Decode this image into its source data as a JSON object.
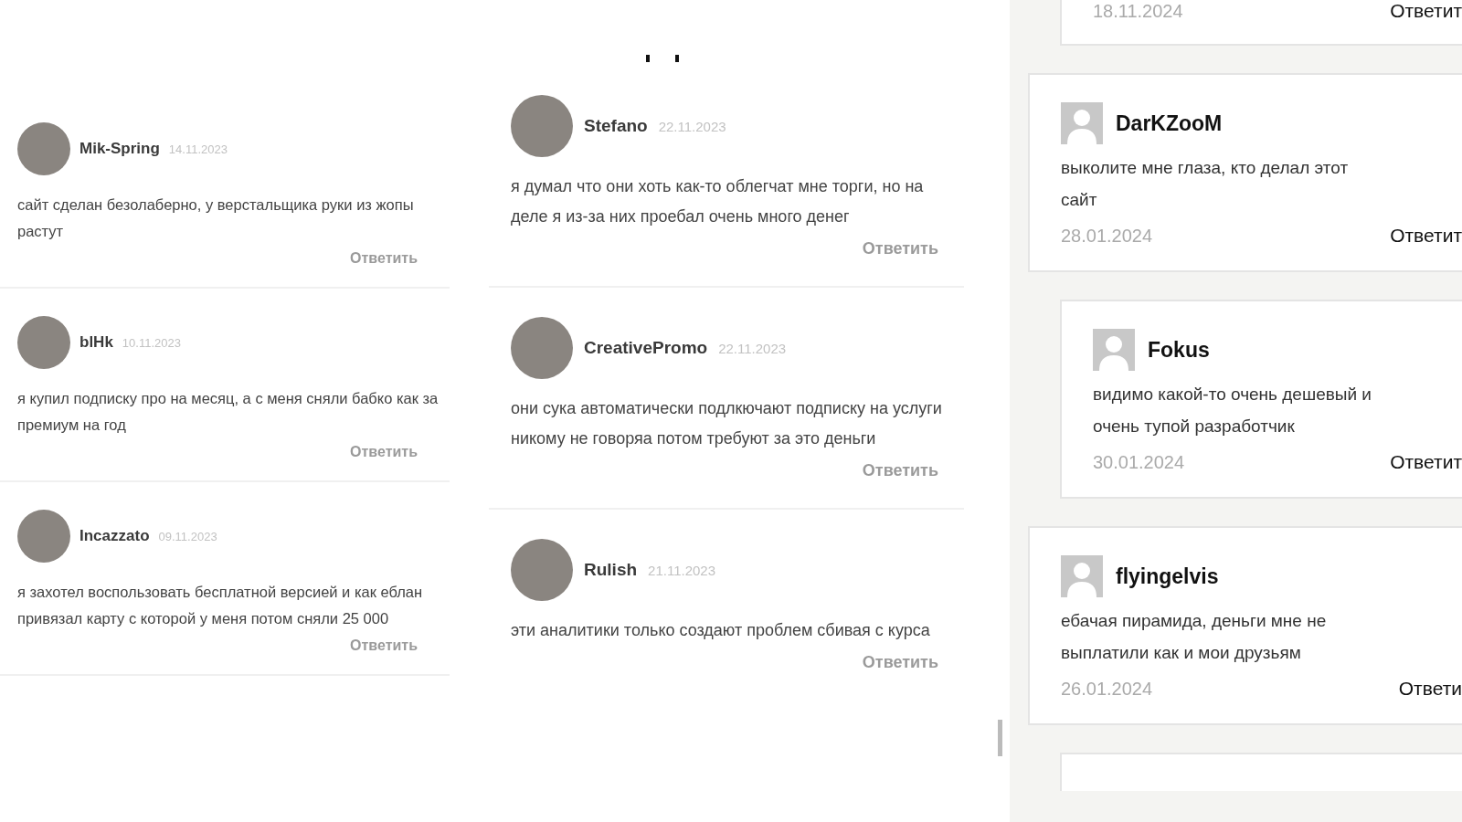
{
  "left_column": {
    "comments": [
      {
        "author": "Mik-Spring",
        "date": "14.11.2023",
        "text": "сайт сделан безолаберно, у верстальщика руки из жопы растут",
        "reply": "Ответить"
      },
      {
        "author": "blHk",
        "date": "10.11.2023",
        "text": "я купил подписку про на месяц, а с меня сняли бабко как за премиум на год",
        "reply": "Ответить"
      },
      {
        "author": "Incazzato",
        "date": "09.11.2023",
        "text": "я захотел воспользовать бесплатной версией и как еблан привязал карту с которой у меня потом сняли 25 000",
        "reply": "Ответить"
      }
    ]
  },
  "middle_column": {
    "comments": [
      {
        "author": "Stefano",
        "date": "22.11.2023",
        "text": "я думал что они хоть как-то облегчат мне торги, но на деле я из-за них проебал очень много денег",
        "reply": "Ответить"
      },
      {
        "author": "CreativePromo",
        "date": "22.11.2023",
        "text": "они сука автоматически подлкючают подписку на услуги никому не говоряа потом требуют за это деньги",
        "reply": "Ответить"
      },
      {
        "author": "Rulish",
        "date": "21.11.2023",
        "text": "эти аналитики только создают проблем сбивая с курса",
        "reply": "Ответить"
      }
    ]
  },
  "right_column": {
    "partial_comment": {
      "date": "18.11.2024",
      "reply": "Ответит"
    },
    "comments": [
      {
        "author": "DarKZooM",
        "text": "выколите мне глаза, кто делал этот сайт",
        "date": "28.01.2024",
        "reply": "Ответит",
        "nested": false
      },
      {
        "author": "Fokus",
        "text": "видимо какой-то очень дешевый и очень тупой разработчик",
        "date": "30.01.2024",
        "reply": "Ответит",
        "nested": true
      },
      {
        "author": "flyingelvis",
        "text": "ебачая пирамида, деньги мне не выплатили как и мои друзьям",
        "date": "26.01.2024",
        "reply": "Ответи",
        "nested": false
      }
    ]
  }
}
